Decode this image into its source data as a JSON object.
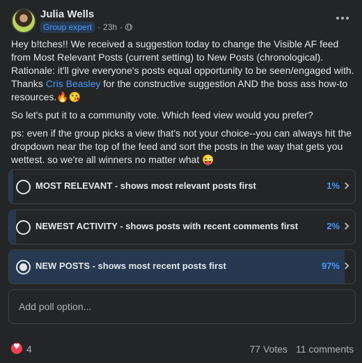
{
  "post": {
    "author": "Julia Wells",
    "badge": "Group expert",
    "time": "23h",
    "separator": "·",
    "body": {
      "p1_a": "Hey b!tches!! We received a suggestion today to change the Visible AF feed from Most Relevant Posts (current setting) to New Posts (chronological). Rationale: it'll give everyone's posts equal opportunity to be seen/engaged with. Thanks ",
      "mention": "Cris Beasley",
      "p1_b": " for the constructive suggestion AND the boss ass how-to resources.🔥😘",
      "p2": "So let's put it to a community vote. Which feed view would you prefer?",
      "p3": "ps: even if the group picks a view that's not your choice--you can always hit the dropdown near the top of the feed and sort the posts in the way that gets you wettest. so we're all winners no matter what 😜"
    }
  },
  "poll": {
    "options": [
      {
        "label": "MOST RELEVANT - shows most relevant posts first",
        "percent_label": "1%",
        "percent": 1,
        "selected": false
      },
      {
        "label": "NEWEST ACTIVITY - shows posts with recent comments first",
        "percent_label": "2%",
        "percent": 2,
        "selected": false
      },
      {
        "label": "NEW POSTS - shows most recent posts first",
        "percent_label": "97%",
        "percent": 97,
        "selected": true
      }
    ],
    "add_option_placeholder": "Add poll option..."
  },
  "footer": {
    "reaction_count": "4",
    "votes": "77 Votes",
    "comments": "11 comments"
  },
  "colors": {
    "background": "#242526",
    "accent": "#4599ff",
    "fill": "#263951",
    "reaction": "#f33e58"
  },
  "icons": [
    "avatar",
    "globe-icon",
    "more-icon",
    "chevron-right-icon",
    "heart-icon"
  ]
}
